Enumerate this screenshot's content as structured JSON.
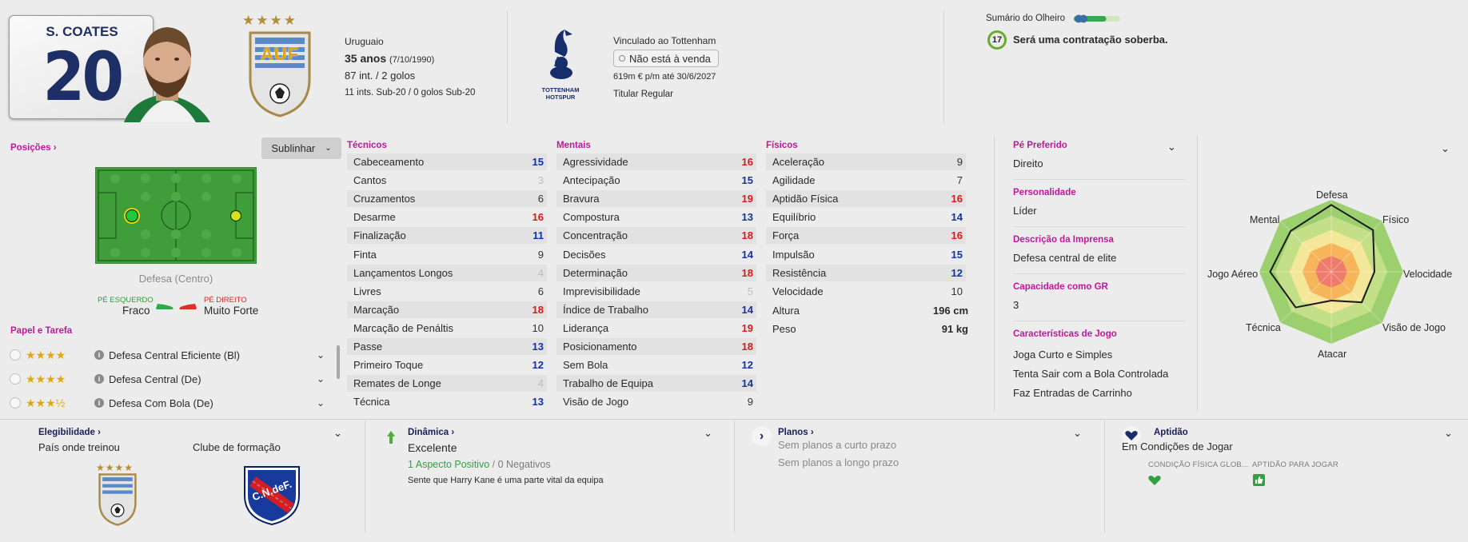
{
  "header": {
    "kit_name": "S. COATES",
    "kit_number": "20",
    "nation": "Uruguaio",
    "age": "35 anos",
    "dob": "(7/10/1990)",
    "caps": "87 int. / 2 golos",
    "youth_caps": "11 ints. Sub-20 / 0 golos Sub-20",
    "badge_stars": "★★★★",
    "badge_text": "AUF",
    "club_link": "Vinculado ao Tottenham",
    "transfer_status": "Não está à venda",
    "contract": "619m € p/m até 30/6/2027",
    "squad_status": "Titular Regular",
    "club_crest_text_1": "TOTTENHAM",
    "club_crest_text_2": "HOTSPUR",
    "scout_title": "Sumário do Olheiro",
    "scout_score": "17",
    "scout_text": "Será uma contratação soberba.",
    "scout_bar_fraction": 0.7
  },
  "positions": {
    "title": "Posições",
    "button_label": "Sublinhar",
    "position_label": "Defesa (Centro)",
    "left_foot_label": "PÉ ESQUERDO",
    "left_foot_value": "Fraco",
    "right_foot_label": "PÉ DIREITO",
    "right_foot_value": "Muito Forte"
  },
  "roles": {
    "title": "Papel e Tarefa",
    "items": [
      {
        "stars": "★★★★",
        "name": "Defesa Central Eficiente (Bl)"
      },
      {
        "stars": "★★★★",
        "name": "Defesa Central (De)"
      },
      {
        "stars": "★★★½",
        "name": "Defesa Com Bola (De)"
      }
    ]
  },
  "attributes": {
    "technical_title": "Técnicos",
    "technical": [
      {
        "name": "Cabeceamento",
        "value": "15",
        "tone": "blue"
      },
      {
        "name": "Cantos",
        "value": "3",
        "tone": "grey"
      },
      {
        "name": "Cruzamentos",
        "value": "6",
        "tone": "norm"
      },
      {
        "name": "Desarme",
        "value": "16",
        "tone": "red"
      },
      {
        "name": "Finalização",
        "value": "11",
        "tone": "blue"
      },
      {
        "name": "Finta",
        "value": "9",
        "tone": "norm"
      },
      {
        "name": "Lançamentos Longos",
        "value": "4",
        "tone": "grey"
      },
      {
        "name": "Livres",
        "value": "6",
        "tone": "norm"
      },
      {
        "name": "Marcação",
        "value": "18",
        "tone": "red"
      },
      {
        "name": "Marcação de Penáltis",
        "value": "10",
        "tone": "norm"
      },
      {
        "name": "Passe",
        "value": "13",
        "tone": "blue"
      },
      {
        "name": "Primeiro Toque",
        "value": "12",
        "tone": "blue"
      },
      {
        "name": "Remates de Longe",
        "value": "4",
        "tone": "grey"
      },
      {
        "name": "Técnica",
        "value": "13",
        "tone": "blue"
      }
    ],
    "mental_title": "Mentais",
    "mental": [
      {
        "name": "Agressividade",
        "value": "16",
        "tone": "red"
      },
      {
        "name": "Antecipação",
        "value": "15",
        "tone": "blue"
      },
      {
        "name": "Bravura",
        "value": "19",
        "tone": "red"
      },
      {
        "name": "Compostura",
        "value": "13",
        "tone": "blue"
      },
      {
        "name": "Concentração",
        "value": "18",
        "tone": "red"
      },
      {
        "name": "Decisões",
        "value": "14",
        "tone": "blue"
      },
      {
        "name": "Determinação",
        "value": "18",
        "tone": "red"
      },
      {
        "name": "Imprevisibilidade",
        "value": "5",
        "tone": "grey"
      },
      {
        "name": "Índice de Trabalho",
        "value": "14",
        "tone": "blue"
      },
      {
        "name": "Liderança",
        "value": "19",
        "tone": "red"
      },
      {
        "name": "Posicionamento",
        "value": "18",
        "tone": "red"
      },
      {
        "name": "Sem Bola",
        "value": "12",
        "tone": "blue"
      },
      {
        "name": "Trabalho de Equipa",
        "value": "14",
        "tone": "blue"
      },
      {
        "name": "Visão de Jogo",
        "value": "9",
        "tone": "norm"
      }
    ],
    "physical_title": "Físicos",
    "physical": [
      {
        "name": "Aceleração",
        "value": "9",
        "tone": "norm"
      },
      {
        "name": "Agilidade",
        "value": "7",
        "tone": "norm"
      },
      {
        "name": "Aptidão Física",
        "value": "16",
        "tone": "red"
      },
      {
        "name": "Equilíbrio",
        "value": "14",
        "tone": "blue"
      },
      {
        "name": "Força",
        "value": "16",
        "tone": "red"
      },
      {
        "name": "Impulsão",
        "value": "15",
        "tone": "blue"
      },
      {
        "name": "Resistência",
        "value": "12",
        "tone": "blue"
      },
      {
        "name": "Velocidade",
        "value": "10",
        "tone": "norm"
      }
    ],
    "height_label": "Altura",
    "height_value": "196 cm",
    "weight_label": "Peso",
    "weight_value": "91 kg"
  },
  "info": {
    "foot_label": "Pé Preferido",
    "foot_value": "Direito",
    "personality_label": "Personalidade",
    "personality_value": "Líder",
    "media_label": "Descrição da Imprensa",
    "media_value": "Defesa central de elite",
    "gk_label": "Capacidade como GR",
    "gk_value": "3",
    "traits_label": "Características de Jogo",
    "traits": [
      "Joga Curto e Simples",
      "Tenta Sair com a Bola Controlada",
      "Faz Entradas de Carrinho"
    ]
  },
  "radar": {
    "labels": [
      "Defesa",
      "Físico",
      "Velocidade",
      "Visão de Jogo",
      "Atacar",
      "Técnica",
      "Jogo Aéreo",
      "Mental"
    ],
    "values": [
      0.93,
      0.82,
      0.6,
      0.6,
      0.4,
      0.7,
      0.85,
      0.8
    ]
  },
  "bottom": {
    "eligibility_title": "Elegibilidade",
    "trained_label": "País onde treinou",
    "club_label": "Clube de formação",
    "club_crest_text": "C.N.deF.",
    "dynamics_title": "Dinâmica",
    "dynamics_value": "Excelente",
    "positives": "1 Aspecto Positivo",
    "negatives": "0 Negativos",
    "dynamics_note": "Sente que Harry Kane é uma parte vital da equipa",
    "plans_title": "Planos",
    "plan_short": "Sem planos a curto prazo",
    "plan_long": "Sem planos a longo prazo",
    "fitness_title": "Aptidão",
    "fitness_value": "Em Condições de Jogar",
    "condition_caption": "CONDIÇÃO FÍSICA GLOB...",
    "match_caption": "APTIDÃO PARA JOGAR"
  }
}
